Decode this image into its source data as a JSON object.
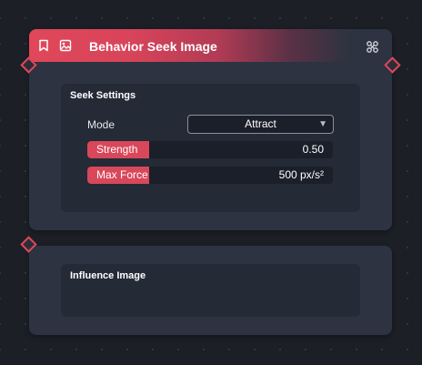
{
  "node": {
    "title": "Behavior Seek Image",
    "icons": {
      "bookmark": "bookmark-icon",
      "image": "image-icon",
      "link": "link-nodes-icon"
    },
    "accent_color": "#e0475a"
  },
  "seek_settings": {
    "title": "Seek Settings",
    "mode": {
      "label": "Mode",
      "value": "Attract"
    },
    "strength": {
      "label": "Strength",
      "value": "0.50",
      "fill_fraction": 0.25
    },
    "max_force": {
      "label": "Max Force",
      "value": "500 px/s²",
      "fill_fraction": 0.25
    }
  },
  "influence": {
    "title": "Influence Image"
  }
}
